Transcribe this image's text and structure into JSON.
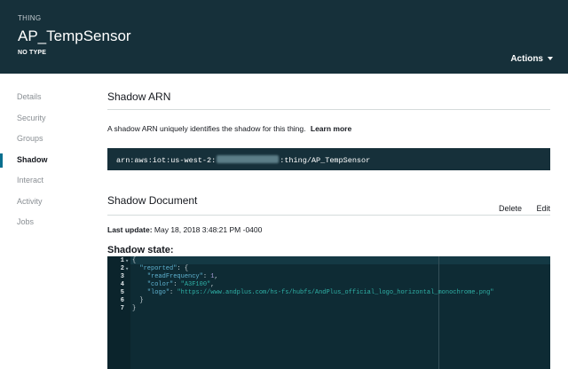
{
  "header": {
    "eyebrow": "THING",
    "title": "AP_TempSensor",
    "subtype": "NO TYPE",
    "actions_label": "Actions"
  },
  "sidebar": {
    "items": [
      {
        "label": "Details",
        "active": false
      },
      {
        "label": "Security",
        "active": false
      },
      {
        "label": "Groups",
        "active": false
      },
      {
        "label": "Shadow",
        "active": true
      },
      {
        "label": "Interact",
        "active": false
      },
      {
        "label": "Activity",
        "active": false
      },
      {
        "label": "Jobs",
        "active": false
      }
    ]
  },
  "shadow_arn": {
    "title": "Shadow ARN",
    "description": "A shadow ARN uniquely identifies the shadow for this thing.",
    "learn_more": "Learn more",
    "arn_prefix": "arn:aws:iot:us-west-2:",
    "arn_suffix": ":thing/AP_TempSensor"
  },
  "shadow_document": {
    "title": "Shadow Document",
    "delete_label": "Delete",
    "edit_label": "Edit",
    "last_update_label": "Last update:",
    "last_update_value": "May 18, 2018 3:48:21 PM -0400",
    "state_label": "Shadow state:",
    "line_numbers": [
      "1",
      "2",
      "3",
      "4",
      "5",
      "6",
      "7"
    ],
    "lines": {
      "l1": "{",
      "l2_key": "\"reported\"",
      "l2_rest": ": {",
      "l3_key": "\"readFrequency\"",
      "l3_sep": ": ",
      "l3_val": "1",
      "l3_end": ",",
      "l4_key": "\"color\"",
      "l4_sep": ": ",
      "l4_val": "\"A3F100\"",
      "l4_end": ",",
      "l5_key": "\"logo\"",
      "l5_sep": ": ",
      "l5_val": "\"https://www.andplus.com/hs-fs/hubfs/AndPlus_official_logo_horizontal_monochrome.png\"",
      "l6": "}",
      "l7": "}"
    }
  },
  "colors": {
    "header_bg": "#16303a",
    "editor_bg": "#0e2b34",
    "active_accent": "#0a6f8f"
  }
}
